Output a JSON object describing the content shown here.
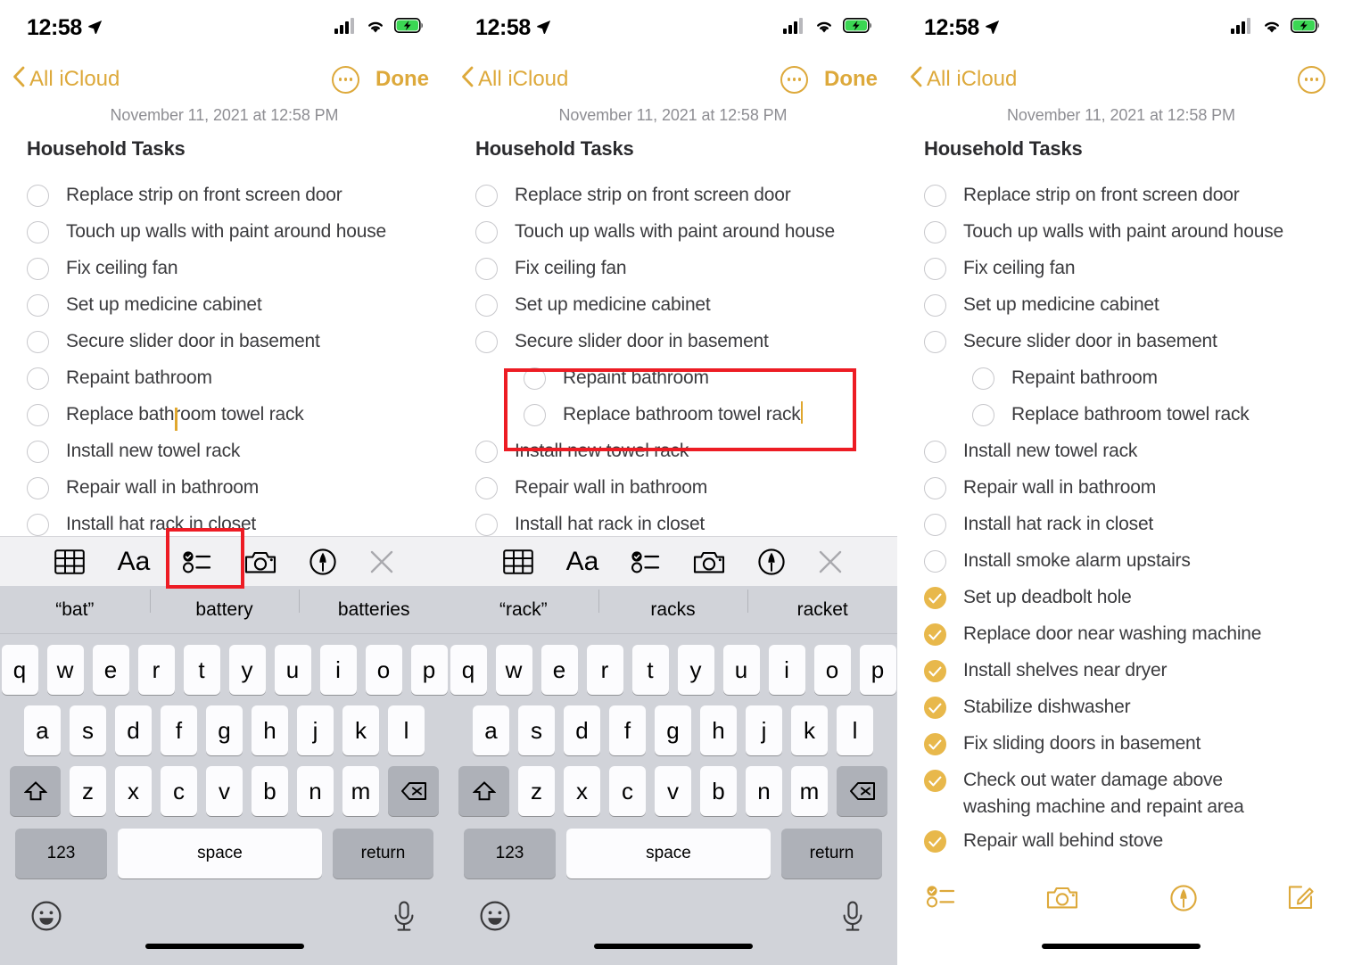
{
  "status_bar": {
    "time": "12:58",
    "location_icon": "location-arrow-icon",
    "cellular_icon": "cellular-signal-icon",
    "wifi_icon": "wifi-icon",
    "battery_icon": "battery-charging-icon"
  },
  "nav": {
    "back_label": "All iCloud",
    "done_label": "Done",
    "more_icon": "ellipsis-circle-icon",
    "back_icon": "chevron-left-icon"
  },
  "note": {
    "date": "November 11, 2021 at 12:58 PM",
    "title": "Household Tasks"
  },
  "colors": {
    "accent": "#DDA93B",
    "checked": "#E8B84B",
    "annotation": "#ED1C24",
    "caret": "#E0A72E"
  },
  "panel1": {
    "items": [
      {
        "label": "Replace strip on front screen door",
        "checked": false,
        "indent": false
      },
      {
        "label": "Touch up walls with paint around house",
        "checked": false,
        "indent": false
      },
      {
        "label": "Fix ceiling fan",
        "checked": false,
        "indent": false
      },
      {
        "label": "Set up medicine cabinet",
        "checked": false,
        "indent": false
      },
      {
        "label": "Secure slider door in basement",
        "checked": false,
        "indent": false
      },
      {
        "label": "Repaint bathroom",
        "checked": false,
        "indent": false
      },
      {
        "label": "Replace bathroom towel rack",
        "checked": false,
        "indent": false
      },
      {
        "label": "Install new towel rack",
        "checked": false,
        "indent": false
      },
      {
        "label": "Repair wall in bathroom",
        "checked": false,
        "indent": false
      },
      {
        "label": "Install hat rack in closet",
        "checked": false,
        "indent": false
      }
    ],
    "suggestions": [
      "“bat”",
      "battery",
      "batteries"
    ],
    "annotation": "checklist-toolbar-button-highlight"
  },
  "panel2": {
    "items": [
      {
        "label": "Replace strip on front screen door",
        "checked": false,
        "indent": false
      },
      {
        "label": "Touch up walls with paint around house",
        "checked": false,
        "indent": false
      },
      {
        "label": "Fix ceiling fan",
        "checked": false,
        "indent": false
      },
      {
        "label": "Set up medicine cabinet",
        "checked": false,
        "indent": false
      },
      {
        "label": "Secure slider door in basement",
        "checked": false,
        "indent": false
      },
      {
        "label": "Repaint bathroom",
        "checked": false,
        "indent": true
      },
      {
        "label": "Replace bathroom towel rack",
        "checked": false,
        "indent": true
      },
      {
        "label": "Install new towel rack",
        "checked": false,
        "indent": false
      },
      {
        "label": "Repair wall in bathroom",
        "checked": false,
        "indent": false
      },
      {
        "label": "Install hat rack in closet",
        "checked": false,
        "indent": false
      }
    ],
    "suggestions": [
      "“rack”",
      "racks",
      "racket"
    ],
    "annotation": "indented-sub-items-highlight"
  },
  "panel3": {
    "items": [
      {
        "label": "Replace strip on front screen door",
        "checked": false,
        "indent": false
      },
      {
        "label": "Touch up walls with paint around house",
        "checked": false,
        "indent": false
      },
      {
        "label": "Fix ceiling fan",
        "checked": false,
        "indent": false
      },
      {
        "label": "Set up medicine cabinet",
        "checked": false,
        "indent": false
      },
      {
        "label": "Secure slider door in basement",
        "checked": false,
        "indent": false
      },
      {
        "label": "Repaint bathroom",
        "checked": false,
        "indent": true
      },
      {
        "label": "Replace bathroom towel rack",
        "checked": false,
        "indent": true
      },
      {
        "label": "Install new towel rack",
        "checked": false,
        "indent": false
      },
      {
        "label": "Repair wall in bathroom",
        "checked": false,
        "indent": false
      },
      {
        "label": "Install hat rack in closet",
        "checked": false,
        "indent": false
      },
      {
        "label": "Install smoke alarm upstairs",
        "checked": false,
        "indent": false
      },
      {
        "label": "Set up deadbolt hole",
        "checked": true,
        "indent": false
      },
      {
        "label": "Replace door near washing machine",
        "checked": true,
        "indent": false
      },
      {
        "label": "Install shelves near dryer",
        "checked": true,
        "indent": false
      },
      {
        "label": "Stabilize dishwasher",
        "checked": true,
        "indent": false
      },
      {
        "label": "Fix sliding doors in basement",
        "checked": true,
        "indent": false
      },
      {
        "label": "Check out water damage above\nwashing machine and repaint area",
        "checked": true,
        "indent": false,
        "tall": true
      },
      {
        "label": "Repair wall behind stove",
        "checked": true,
        "indent": false
      }
    ]
  },
  "format_toolbar": {
    "buttons": [
      {
        "name": "table-icon",
        "label": "table"
      },
      {
        "name": "text-format-icon",
        "label": "Aa"
      },
      {
        "name": "checklist-icon",
        "label": "checklist"
      },
      {
        "name": "camera-icon",
        "label": "camera"
      },
      {
        "name": "markup-pen-icon",
        "label": "markup"
      },
      {
        "name": "close-icon",
        "label": "close"
      }
    ]
  },
  "note_toolbar": {
    "buttons": [
      {
        "name": "checklist-icon",
        "label": "checklist"
      },
      {
        "name": "camera-icon",
        "label": "camera"
      },
      {
        "name": "markup-pen-icon",
        "label": "markup"
      },
      {
        "name": "compose-icon",
        "label": "compose"
      }
    ]
  },
  "keyboard": {
    "row1": [
      "q",
      "w",
      "e",
      "r",
      "t",
      "y",
      "u",
      "i",
      "o",
      "p"
    ],
    "row2": [
      "a",
      "s",
      "d",
      "f",
      "g",
      "h",
      "j",
      "k",
      "l"
    ],
    "row3": [
      "z",
      "x",
      "c",
      "v",
      "b",
      "n",
      "m"
    ],
    "shift_icon": "shift-up-arrow-icon",
    "backspace_icon": "backspace-delete-icon",
    "numbers_label": "123",
    "space_label": "space",
    "return_label": "return",
    "emoji_icon": "emoji-smiley-icon",
    "dictation_icon": "microphone-icon"
  }
}
